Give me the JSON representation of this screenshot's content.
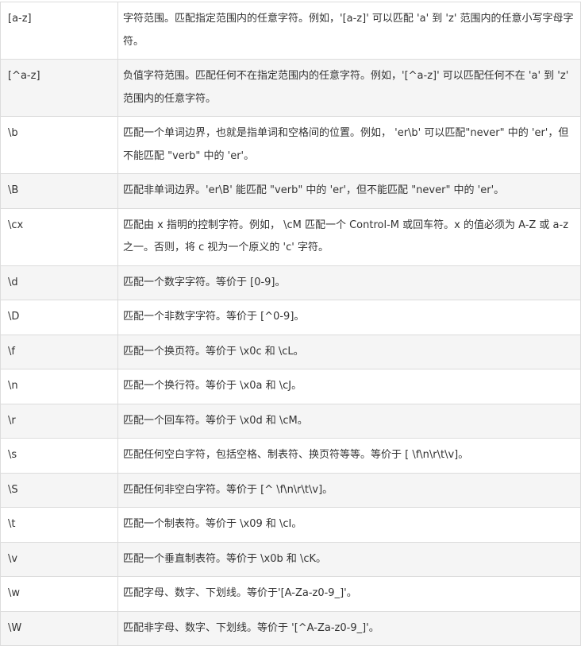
{
  "rows": [
    {
      "char": "[a-z]",
      "desc": "字符范围。匹配指定范围内的任意字符。例如，'[a-z]' 可以匹配 'a' 到 'z' 范围内的任意小写字母字符。"
    },
    {
      "char": "[^a-z]",
      "desc": "负值字符范围。匹配任何不在指定范围内的任意字符。例如，'[^a-z]' 可以匹配任何不在 'a' 到 'z' 范围内的任意字符。"
    },
    {
      "char": "\\b",
      "desc": "匹配一个单词边界，也就是指单词和空格间的位置。例如， 'er\\b' 可以匹配\"never\" 中的 'er'，但不能匹配 \"verb\" 中的 'er'。"
    },
    {
      "char": "\\B",
      "desc": "匹配非单词边界。'er\\B' 能匹配 \"verb\" 中的 'er'，但不能匹配 \"never\" 中的 'er'。"
    },
    {
      "char": "\\cx",
      "desc": "匹配由 x 指明的控制字符。例如， \\cM 匹配一个 Control-M 或回车符。x 的值必须为 A-Z 或 a-z 之一。否则，将 c 视为一个原义的 'c' 字符。"
    },
    {
      "char": "\\d",
      "desc": "匹配一个数字字符。等价于 [0-9]。"
    },
    {
      "char": "\\D",
      "desc": "匹配一个非数字字符。等价于 [^0-9]。"
    },
    {
      "char": "\\f",
      "desc": "匹配一个换页符。等价于 \\x0c 和 \\cL。"
    },
    {
      "char": "\\n",
      "desc": "匹配一个换行符。等价于 \\x0a 和 \\cJ。"
    },
    {
      "char": "\\r",
      "desc": "匹配一个回车符。等价于 \\x0d 和 \\cM。"
    },
    {
      "char": "\\s",
      "desc": "匹配任何空白字符，包括空格、制表符、换页符等等。等价于 [ \\f\\n\\r\\t\\v]。"
    },
    {
      "char": "\\S",
      "desc": "匹配任何非空白字符。等价于 [^ \\f\\n\\r\\t\\v]。"
    },
    {
      "char": "\\t",
      "desc": "匹配一个制表符。等价于 \\x09 和 \\cI。"
    },
    {
      "char": "\\v",
      "desc": "匹配一个垂直制表符。等价于 \\x0b 和 \\cK。"
    },
    {
      "char": "\\w",
      "desc": "匹配字母、数字、下划线。等价于'[A-Za-z0-9_]'。"
    },
    {
      "char": "\\W",
      "desc": "匹配非字母、数字、下划线。等价于 '[^A-Za-z0-9_]'。"
    }
  ]
}
